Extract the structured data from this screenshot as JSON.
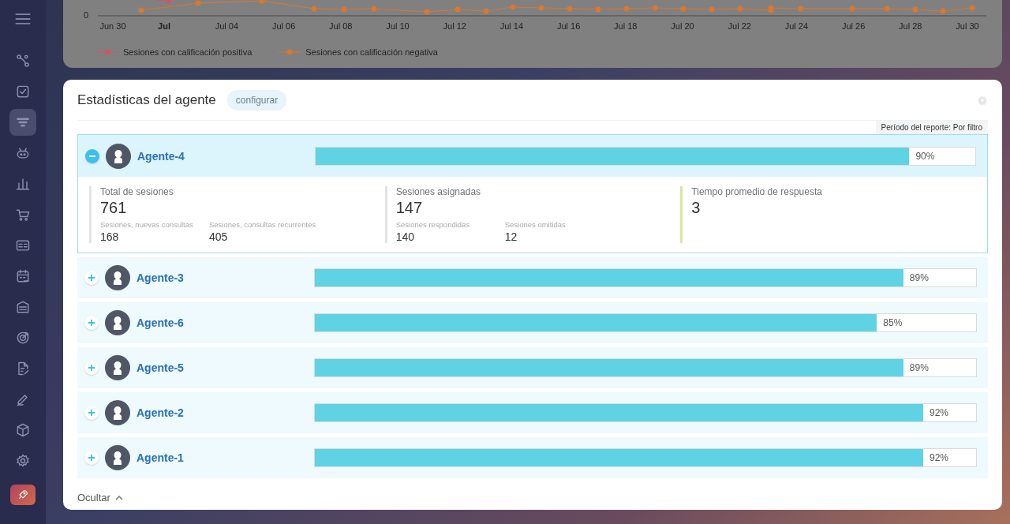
{
  "sidebar": {
    "items": [
      {
        "selected": false
      },
      {
        "selected": false
      },
      {
        "selected": true
      },
      {
        "selected": false
      },
      {
        "selected": false
      },
      {
        "selected": false
      },
      {
        "selected": false
      },
      {
        "selected": false
      },
      {
        "selected": false
      },
      {
        "selected": false
      },
      {
        "selected": false
      },
      {
        "selected": false
      },
      {
        "selected": false
      },
      {
        "selected": false
      }
    ]
  },
  "top_chart": {
    "y_label": "0",
    "x_labels": [
      {
        "text": "Jun 30",
        "bold": false
      },
      {
        "text": "Jul",
        "bold": true
      },
      {
        "text": "Jul 04",
        "bold": false
      },
      {
        "text": "Jul 06",
        "bold": false
      },
      {
        "text": "Jul 08",
        "bold": false
      },
      {
        "text": "Jul 10",
        "bold": false
      },
      {
        "text": "Jul 12",
        "bold": false
      },
      {
        "text": "Jul 14",
        "bold": false
      },
      {
        "text": "Jul 16",
        "bold": false
      },
      {
        "text": "Jul 18",
        "bold": false
      },
      {
        "text": "Jul 20",
        "bold": false
      },
      {
        "text": "Jul 22",
        "bold": false
      },
      {
        "text": "Jul 24",
        "bold": false
      },
      {
        "text": "Jul 26",
        "bold": false
      },
      {
        "text": "Jul 28",
        "bold": false
      },
      {
        "text": "Jul 30",
        "bold": false
      }
    ],
    "legend": [
      {
        "label": "Sesiones con calificación positiva",
        "color": "#c8576a"
      },
      {
        "label": "Sesiones con calificación negativa",
        "color": "#d9782e"
      }
    ]
  },
  "panel": {
    "title": "Estadísticas del agente",
    "configure_button": "configurar",
    "period": "Período del reporte: Por filtro",
    "hide_link": "Ocultar",
    "agents": [
      {
        "name": "Agente-4",
        "expanded": true,
        "level": 0.9,
        "reading": "90%",
        "stats": [
          {
            "label": "Total de sesiones",
            "value": "761",
            "color": "#e2e4e6",
            "details": [
              {
                "label": "Sesiones, nuevas consultas",
                "value": "168"
              },
              {
                "label": "Sesiones, consultas recurrentes",
                "value": "405"
              }
            ]
          },
          {
            "label": "Sesiones asignadas",
            "value": "147",
            "color": "#e2e4e6",
            "details": [
              {
                "label": "Sesiones respondidas",
                "value": "140"
              },
              {
                "label": "Sesiones omitidas",
                "value": "12"
              }
            ]
          },
          {
            "label": "Tiempo promedio de respuesta",
            "value": "3",
            "color": "#d6e89c"
          }
        ]
      },
      {
        "name": "Agente-3",
        "expanded": false,
        "level": 0.89,
        "reading": "89%"
      },
      {
        "name": "Agente-6",
        "expanded": false,
        "level": 0.85,
        "reading": "85%"
      },
      {
        "name": "Agente-5",
        "expanded": false,
        "level": 0.89,
        "reading": "89%"
      },
      {
        "name": "Agente-2",
        "expanded": false,
        "level": 0.92,
        "reading": "92%"
      },
      {
        "name": "Agente-1",
        "expanded": false,
        "level": 0.92,
        "reading": "92%"
      }
    ]
  }
}
